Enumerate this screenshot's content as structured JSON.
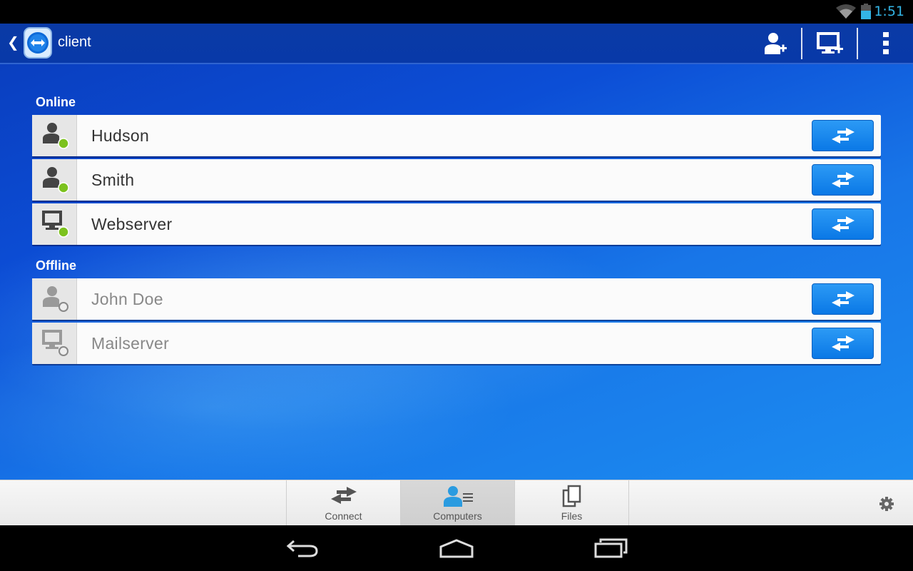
{
  "status_bar": {
    "time": "1:51"
  },
  "action_bar": {
    "title": "client",
    "actions": [
      "add-contact",
      "add-computer",
      "overflow-menu"
    ]
  },
  "sections": [
    {
      "label": "Online",
      "items": [
        {
          "name": "Hudson",
          "type": "contact",
          "status": "online"
        },
        {
          "name": "Smith",
          "type": "contact",
          "status": "online"
        },
        {
          "name": "Webserver",
          "type": "computer",
          "status": "online"
        }
      ]
    },
    {
      "label": "Offline",
      "items": [
        {
          "name": "John Doe",
          "type": "contact",
          "status": "offline"
        },
        {
          "name": "Mailserver",
          "type": "computer",
          "status": "offline"
        }
      ]
    }
  ],
  "tabs": [
    {
      "label": "Connect",
      "icon": "arrows-icon",
      "selected": false
    },
    {
      "label": "Computers",
      "icon": "computers-icon",
      "selected": true
    },
    {
      "label": "Files",
      "icon": "files-icon",
      "selected": false
    }
  ],
  "colors": {
    "action_bar": "#0839a8",
    "online_dot": "#7cc21e",
    "connect_button": "#1a8af0",
    "status_bar_text": "#33b5e5"
  }
}
